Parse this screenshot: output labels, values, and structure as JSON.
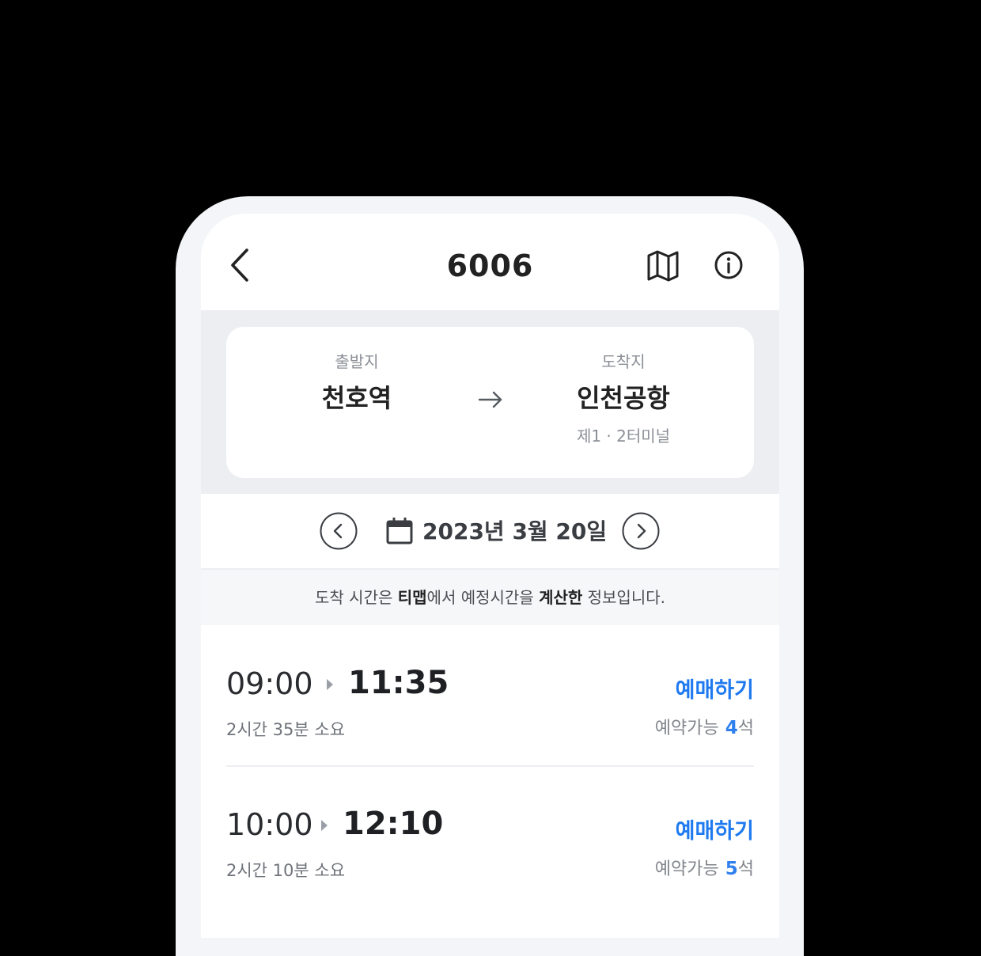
{
  "header": {
    "title": "6006"
  },
  "route": {
    "departure_label": "출발지",
    "departure_name": "천호역",
    "arrival_label": "도착지",
    "arrival_name": "인천공항",
    "arrival_sub": "제1 · 2터미널"
  },
  "date": {
    "text": "2023년 3월 20일"
  },
  "notice": {
    "part1": "도착 시간은 ",
    "bold1": "티맵",
    "part2": "에서 예정시간을 ",
    "bold2": "계산한",
    "part3": " 정보입니다."
  },
  "schedules": [
    {
      "departure": "09:00",
      "arrival": "11:35",
      "duration": "2시간 35분 소요",
      "book_label": "예매하기",
      "seats_label": "예약가능",
      "seats_count": "4",
      "seats_unit": "석"
    },
    {
      "departure": "10:00",
      "arrival": "12:10",
      "duration": "2시간 10분 소요",
      "book_label": "예매하기",
      "seats_label": "예약가능",
      "seats_count": "5",
      "seats_unit": "석"
    }
  ],
  "colors": {
    "accent": "#1f7af0",
    "seat_count": "#2f80ed",
    "background": "#000000"
  },
  "icons": {
    "back": "chevron-left-icon",
    "map": "map-icon",
    "info": "info-icon",
    "route_arrow": "arrow-right-icon",
    "calendar": "calendar-icon",
    "prev_date": "chevron-left-circle-icon",
    "next_date": "chevron-right-circle-icon"
  }
}
